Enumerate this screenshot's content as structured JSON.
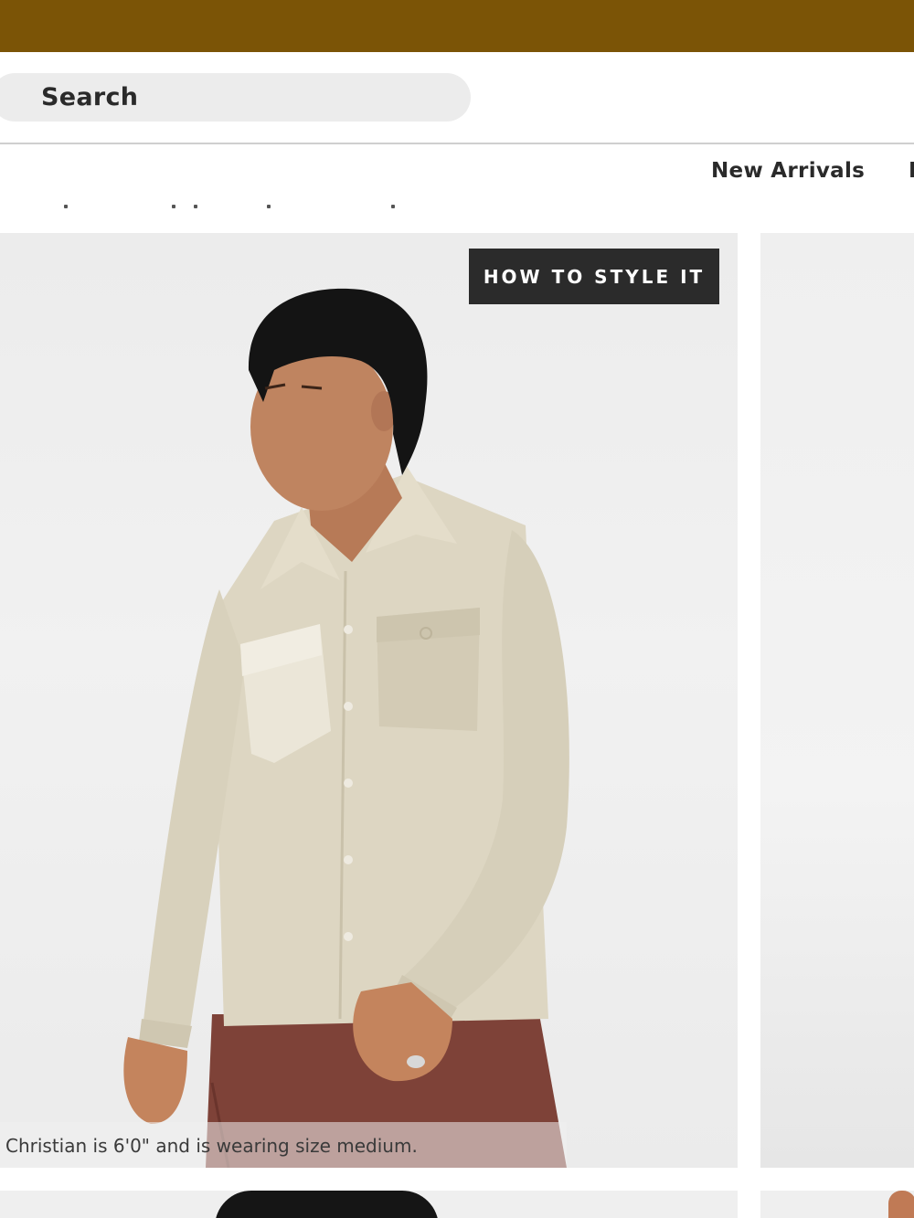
{
  "promo": {
    "color": "#7b5406"
  },
  "search": {
    "label": "Search"
  },
  "nav": {
    "items": [
      "New Arrivals"
    ]
  },
  "product": {
    "badge": "HOW TO STYLE IT",
    "caption": "Christian is 6'0\" and is wearing size medium.",
    "image": "model-wearing-beige-long-sleeve-utility-shirt"
  },
  "icons": {
    "search": "search-icon"
  }
}
